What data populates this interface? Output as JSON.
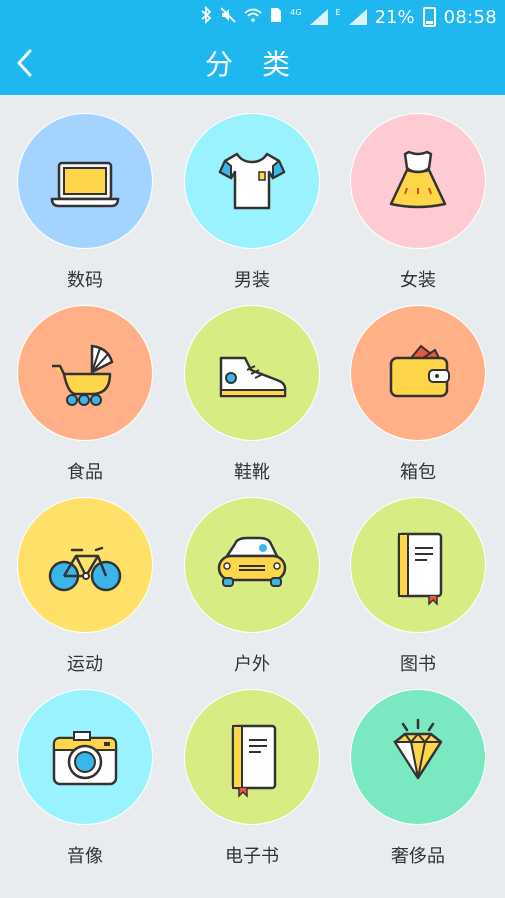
{
  "status": {
    "network": "4G",
    "network2": "E",
    "battery_percent": "21%",
    "time": "08:58"
  },
  "header": {
    "title": "分 类"
  },
  "categories": [
    {
      "label": "数码",
      "icon": "laptop-icon",
      "bg": "#a5d3ff"
    },
    {
      "label": "男装",
      "icon": "tshirt-icon",
      "bg": "#9af2ff"
    },
    {
      "label": "女装",
      "icon": "dress-icon",
      "bg": "#ffcbd3"
    },
    {
      "label": "食品",
      "icon": "stroller-icon",
      "bg": "#ffb086"
    },
    {
      "label": "鞋靴",
      "icon": "sneaker-icon",
      "bg": "#d8ec84"
    },
    {
      "label": "箱包",
      "icon": "wallet-icon",
      "bg": "#ffb086"
    },
    {
      "label": "运动",
      "icon": "bicycle-icon",
      "bg": "#ffe069"
    },
    {
      "label": "户外",
      "icon": "car-icon",
      "bg": "#d8ec84"
    },
    {
      "label": "图书",
      "icon": "book-icon",
      "bg": "#d8ec84"
    },
    {
      "label": "音像",
      "icon": "camera-icon",
      "bg": "#9af2ff"
    },
    {
      "label": "电子书",
      "icon": "ebook-icon",
      "bg": "#d8ec84"
    },
    {
      "label": "奢侈品",
      "icon": "diamond-icon",
      "bg": "#7ae8c0"
    }
  ]
}
